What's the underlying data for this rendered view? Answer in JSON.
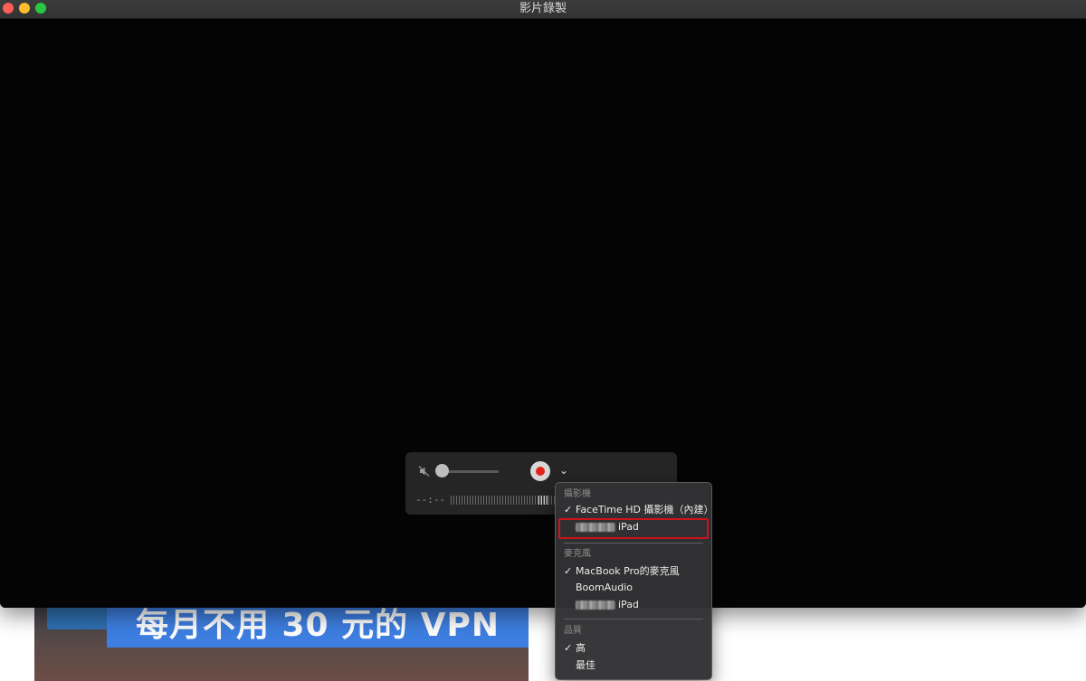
{
  "window": {
    "title": "影片錄製"
  },
  "controller": {
    "timecode": "--:--",
    "volume_level": 0.1,
    "icons": {
      "mute": "speaker-muted-icon",
      "record": "record-icon",
      "options": "chevron-down-icon"
    },
    "chevron_glyph": "⌄"
  },
  "menu": {
    "camera_section": "攝影機",
    "camera_items": [
      {
        "label": "FaceTime HD 攝影機（內建）",
        "checked": true
      },
      {
        "label": "iPad",
        "checked": false
      }
    ],
    "mic_section": "麥克風",
    "mic_items": [
      {
        "label": "MacBook Pro的麥克風",
        "checked": true
      },
      {
        "label": "BoomAudio",
        "checked": false
      },
      {
        "label": "iPad",
        "checked": false
      }
    ],
    "quality_section": "品質",
    "quality_items": [
      {
        "label": "高",
        "checked": true
      },
      {
        "label": "最佳",
        "checked": false
      }
    ],
    "check_glyph": "✓"
  },
  "background": {
    "banner_text": "每月不用 30 元的 VPN"
  },
  "colors": {
    "record_red": "#e3231b",
    "highlight_red": "#d0121b",
    "banner_blue": "#3d7ee0"
  }
}
